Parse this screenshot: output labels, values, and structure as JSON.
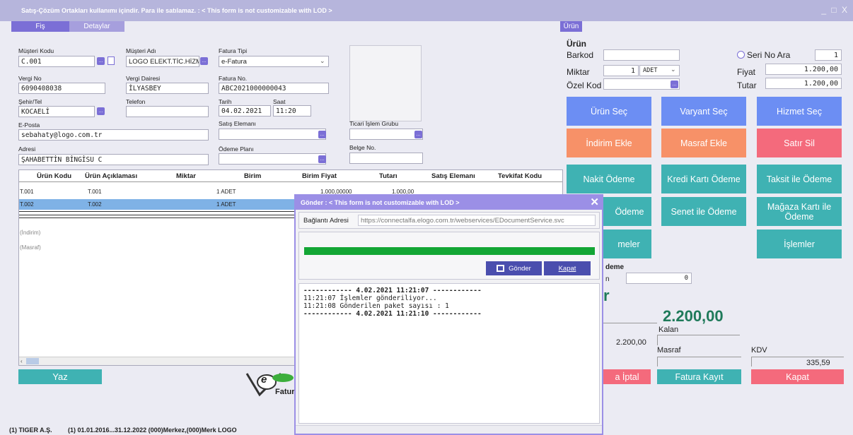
{
  "window": {
    "title": "Satış-Çözüm Ortakları kullanımı içindir. Para ile satılamaz. : < This form is not customizable with LOD >",
    "controls": "_ □ X"
  },
  "tabs": {
    "fis": "Fiş",
    "detaylar": "Detaylar"
  },
  "header_form": {
    "musteri_kodu": {
      "label": "Müşteri Kodu",
      "value": "C.001"
    },
    "musteri_adi": {
      "label": "Müşteri Adı",
      "value": "LOGO ELEKT.TİC.HİZM"
    },
    "fatura_tipi": {
      "label": "Fatura Tipi",
      "value": "e-Fatura"
    },
    "vergi_no": {
      "label": "Vergi No",
      "value": "6090408038"
    },
    "vergi_dairesi": {
      "label": "Vergi Dairesi",
      "value": "İLYASBEY"
    },
    "fatura_no": {
      "label": "Fatura No.",
      "value": "ABC2021000000043"
    },
    "sehir_tel": {
      "label": "Şehir/Tel",
      "value": "KOCAELİ"
    },
    "telefon": {
      "label": "Telefon",
      "value": ""
    },
    "tarih": {
      "label": "Tarih",
      "value": "04.02.2021"
    },
    "saat": {
      "label": "Saat",
      "value": "11:20"
    },
    "eposta": {
      "label": "E-Posta",
      "value": "sebahaty@logo.com.tr"
    },
    "satis_elemani": {
      "label": "Satış Elemanı",
      "value": ""
    },
    "ticari_islem_grubu": {
      "label": "Ticari İşlem Grubu",
      "value": ""
    },
    "adresi": {
      "label": "Adresi",
      "value": "ŞAHABETTİN BİNGİSU C"
    },
    "odeme_plani": {
      "label": "Ödeme Planı",
      "value": ""
    },
    "belge_no": {
      "label": "Belge No.",
      "value": ""
    }
  },
  "grid": {
    "columns": [
      "Ürün Kodu",
      "Ürün Açıklaması",
      "Miktar",
      "Birim",
      "Birim Fiyat",
      "Tutarı",
      "Satış Elemanı",
      "Tevkifat Kodu"
    ],
    "rows": [
      {
        "kod": "T.001",
        "aciklama": "T.001",
        "birim": "1 ADET",
        "fiyat": "1.000,00000",
        "tutar": "1.000,00"
      },
      {
        "kod": "T.002",
        "aciklama": "T.002",
        "birim": "1 ADET"
      }
    ],
    "indirim": "(İndirim)",
    "masraf": "(Masraf)"
  },
  "yaz_button": "Yaz",
  "efatura_logo": {
    "e": "e",
    "text": "Fatur"
  },
  "urun_panel": {
    "tab": "Ürün",
    "heading": "Ürün",
    "barkod": {
      "label": "Barkod",
      "value": ""
    },
    "seri_no_ara": {
      "label": "Seri No Ara",
      "value": "1"
    },
    "miktar": {
      "label": "Miktar",
      "value": "1",
      "unit": "ADET"
    },
    "fiyat": {
      "label": "Fiyat",
      "value": "1.200,00"
    },
    "ozel_kod": {
      "label": "Özel Kod",
      "value": ""
    },
    "tutar": {
      "label": "Tutar",
      "value": "1.200,00"
    }
  },
  "action_buttons": {
    "urun_sec": "Ürün Seç",
    "varyant_sec": "Varyant Seç",
    "hizmet_sec": "Hizmet Seç",
    "indirim_ekle": "İndirim Ekle",
    "masraf_ekle": "Masraf Ekle",
    "satir_sil": "Satır Sil",
    "nakit_odeme": "Nakit Ödeme",
    "kredi_karti_odeme": "Kredi Kartı Ödeme",
    "taksit_odeme": "Taksit ile Ödeme",
    "odeme_partial": "Ödeme",
    "senet_odeme": "Senet ile Ödeme",
    "magaza_karti_odeme": "Mağaza Kartı ile Ödeme",
    "islemler_partial": "meler",
    "islemler": "İşlemler"
  },
  "summary": {
    "odeme_partial": "deme",
    "n_partial": "n",
    "field_value": "0",
    "r_partial": "r",
    "total": "2.200,00",
    "kalan_label": "Kalan",
    "subtotal": "2.200,00",
    "masraf_label": "Masraf",
    "kdv_label": "KDV",
    "kdv_value": "335,59"
  },
  "bottom_buttons": {
    "iptal": "a İptal",
    "fatura_kayit": "Fatura Kayıt",
    "kapat": "Kapat"
  },
  "status_bar": {
    "company": "(1) TIGER A.Ş.",
    "info": "(1) 01.01.2016...31.12.2022  (000)Merkez,(000)Merk LOGO"
  },
  "dialog": {
    "title": "Gönder : < This form is not customizable with LOD >",
    "connection_label": "Bağlantı Adresi",
    "connection_url": "https://connectalfa.elogo.com.tr/webservices/EDocumentService.svc",
    "progress": 1.0,
    "send_button": "Gönder",
    "close_button": "Kapat",
    "log": [
      "------------ 4.02.2021 11:21:07 ------------",
      "11:21:07 İşlemler gönderiliyor...",
      "11:21:08 Gönderilen paket sayısı : 1",
      "------------ 4.02.2021 11:21:10 ------------"
    ]
  },
  "colors": {
    "accent_purple": "#7b6fd6",
    "blue_button": "#6c8ef3",
    "orange_button": "#f79168",
    "red_button": "#f46a7c",
    "teal_button": "#3fb2b3",
    "total_green": "#1f7a5a",
    "progress_green": "#13a635"
  }
}
